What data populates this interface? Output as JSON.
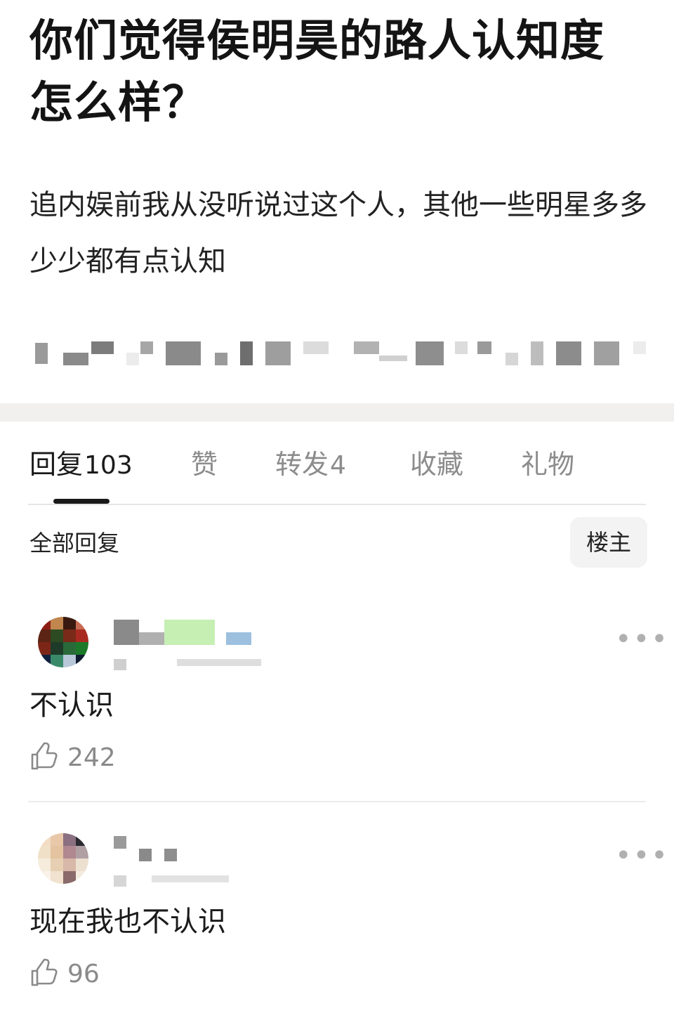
{
  "post": {
    "title": "你们觉得侯明昊的路人认知度怎么样？",
    "body": "追内娱前我从没听说过这个人，其他一些明星多多少少都有点认知"
  },
  "tabs": [
    {
      "label": "回复",
      "count": "103"
    },
    {
      "label": "赞",
      "count": ""
    },
    {
      "label": "转发",
      "count": "4"
    },
    {
      "label": "收藏",
      "count": ""
    },
    {
      "label": "礼物",
      "count": ""
    }
  ],
  "filter": {
    "title": "全部回复",
    "author_only": "楼主"
  },
  "comments": [
    {
      "text": "不认识",
      "likes": "242",
      "more": "•••"
    },
    {
      "text": "现在我也不认识",
      "likes": "96",
      "more": "•••"
    }
  ],
  "icons": {
    "like": "thumbs-up-icon",
    "more": "more-dots-icon"
  }
}
